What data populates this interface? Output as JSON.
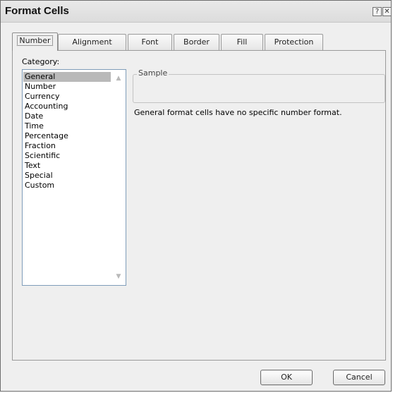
{
  "window": {
    "title": "Format Cells",
    "help_glyph": "?",
    "close_glyph": "✕"
  },
  "tabs": [
    {
      "label": "Number",
      "active": true
    },
    {
      "label": "Alignment",
      "active": false
    },
    {
      "label": "Font",
      "active": false
    },
    {
      "label": "Border",
      "active": false
    },
    {
      "label": "Fill",
      "active": false
    },
    {
      "label": "Protection",
      "active": false
    }
  ],
  "category": {
    "label": "Category:",
    "items": [
      "General",
      "Number",
      "Currency",
      "Accounting",
      "Date",
      "Time",
      "Percentage",
      "Fraction",
      "Scientific",
      "Text",
      "Special",
      "Custom"
    ],
    "selected": "General"
  },
  "sample": {
    "legend": "Sample",
    "value": ""
  },
  "description": "General format cells have no specific number format.",
  "buttons": {
    "ok": "OK",
    "cancel": "Cancel"
  },
  "icons": {
    "help": "help-icon",
    "close": "close-icon",
    "scroll_up": "scroll-up-arrow-icon",
    "scroll_down": "scroll-down-arrow-icon"
  }
}
